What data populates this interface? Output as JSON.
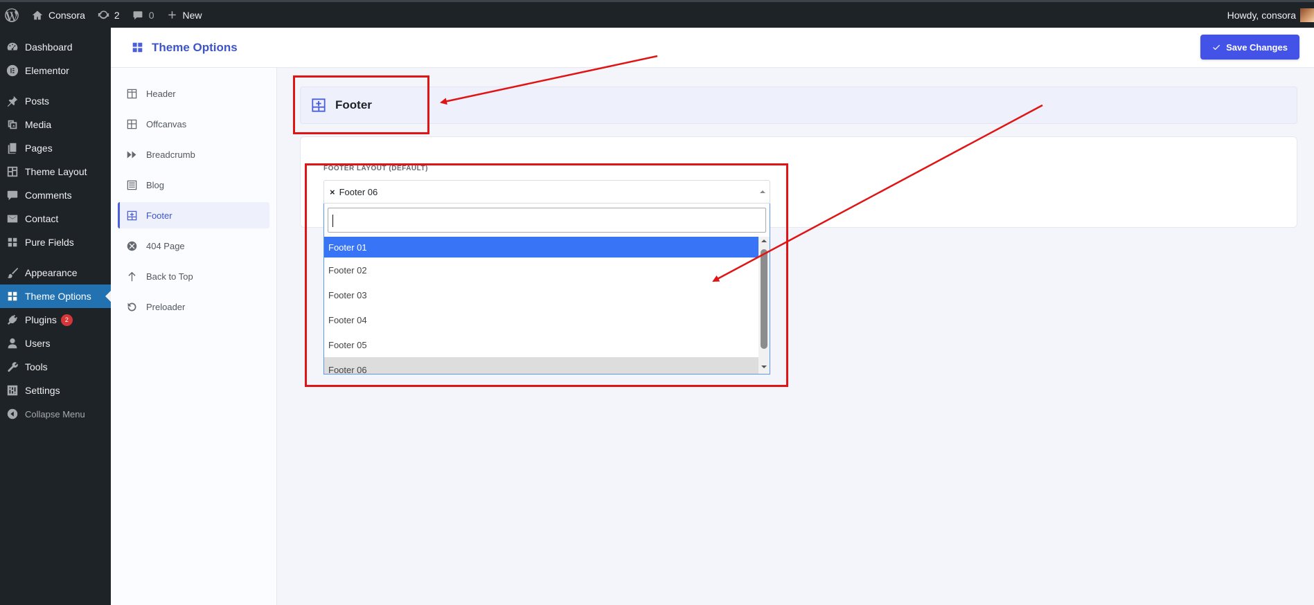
{
  "adminbar": {
    "site_name": "Consora",
    "updates_count": "2",
    "comments_count": "0",
    "new_label": "New",
    "greeting": "Howdy, consora"
  },
  "adminmenu": {
    "items": [
      {
        "label": "Dashboard",
        "icon": "dashboard-icon"
      },
      {
        "label": "Elementor",
        "icon": "elementor-icon"
      },
      {
        "label": "Posts",
        "icon": "pin-icon"
      },
      {
        "label": "Media",
        "icon": "media-icon"
      },
      {
        "label": "Pages",
        "icon": "pages-icon"
      },
      {
        "label": "Theme Layout",
        "icon": "layout-icon"
      },
      {
        "label": "Comments",
        "icon": "comment-icon"
      },
      {
        "label": "Contact",
        "icon": "mail-icon"
      },
      {
        "label": "Pure Fields",
        "icon": "grid-icon"
      },
      {
        "label": "Appearance",
        "icon": "brush-icon"
      },
      {
        "label": "Theme Options",
        "icon": "grid-icon"
      },
      {
        "label": "Plugins",
        "icon": "plugin-icon",
        "badge": "2"
      },
      {
        "label": "Users",
        "icon": "user-icon"
      },
      {
        "label": "Tools",
        "icon": "wrench-icon"
      },
      {
        "label": "Settings",
        "icon": "settings-icon"
      },
      {
        "label": "Collapse Menu",
        "icon": "collapse-icon"
      }
    ]
  },
  "theme_options": {
    "title": "Theme Options",
    "save_label": "Save Changes",
    "nav": [
      {
        "label": "Header",
        "icon": "header-layout-icon"
      },
      {
        "label": "Offcanvas",
        "icon": "table-icon"
      },
      {
        "label": "Breadcrumb",
        "icon": "fast-forward-icon"
      },
      {
        "label": "Blog",
        "icon": "list-icon"
      },
      {
        "label": "Footer",
        "icon": "footer-layout-icon",
        "active": true
      },
      {
        "label": "404 Page",
        "icon": "circle-x-icon"
      },
      {
        "label": "Back to Top",
        "icon": "arrow-up-icon"
      },
      {
        "label": "Preloader",
        "icon": "reload-icon"
      }
    ]
  },
  "section": {
    "title": "Footer"
  },
  "field": {
    "label": "FOOTER LAYOUT (DEFAULT)",
    "selected_value": "Footer 06",
    "clear_symbol": "×",
    "search_value": "",
    "options": [
      "Footer 01",
      "Footer 02",
      "Footer 03",
      "Footer 04",
      "Footer 05",
      "Footer 06"
    ],
    "highlighted_index": 0,
    "selected_index": 5
  },
  "colors": {
    "accent": "#4353e8",
    "wp_blue": "#2271b1",
    "annotation_red": "#e01414"
  }
}
